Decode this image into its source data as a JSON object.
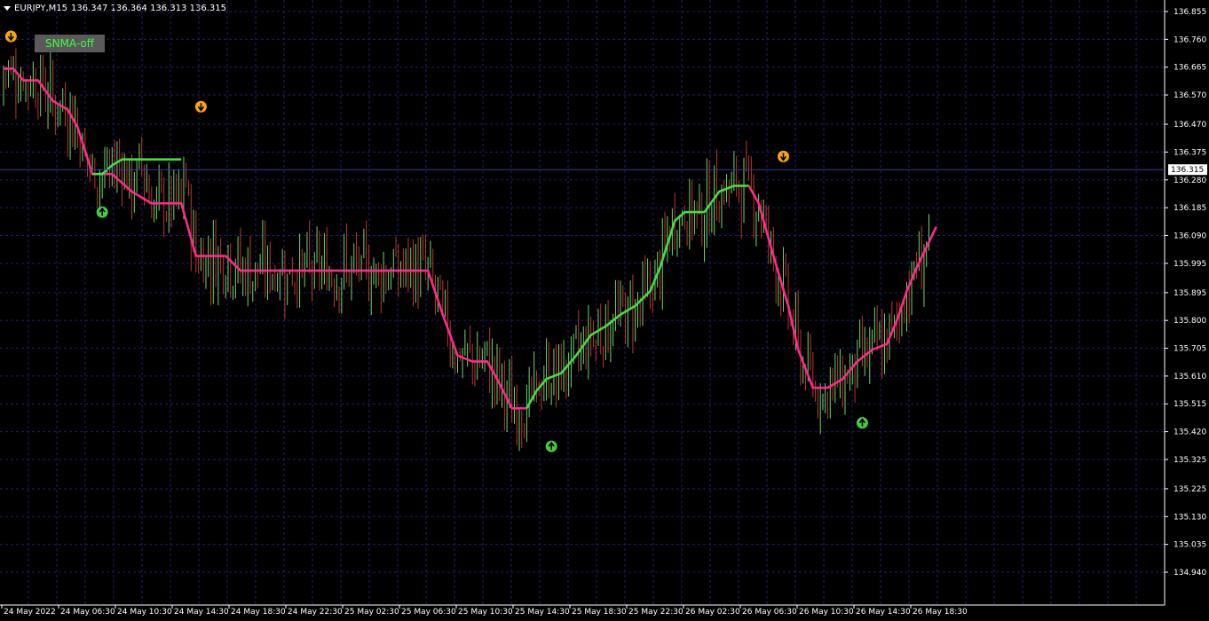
{
  "header": {
    "symbol": "EURJPY,M15",
    "ohlc": "136.347 136.364 136.313 136.315"
  },
  "button": {
    "label": "SNMA-off"
  },
  "colors": {
    "background": "#000000",
    "grid": "#1e1e6e",
    "up_bar": "#6bd66b",
    "down_bar": "#b83a2a",
    "sma_up": "#44dd44",
    "sma_down": "#ff2a8a",
    "arrow_down": "#ffa500",
    "arrow_up": "#44cc44"
  },
  "chart_data": {
    "type": "bar",
    "price_axis": {
      "labels": [
        "136.855",
        "136.760",
        "136.665",
        "136.570",
        "136.470",
        "136.375",
        "136.280",
        "136.185",
        "136.090",
        "135.995",
        "135.895",
        "135.800",
        "135.705",
        "135.610",
        "135.515",
        "135.420",
        "135.325",
        "135.225",
        "135.130",
        "135.035",
        "134.940"
      ],
      "current_price": "136.315",
      "range": [
        134.94,
        136.855
      ]
    },
    "time_axis": {
      "labels": [
        "24 May 2022",
        "24 May 06:30",
        "24 May 10:30",
        "24 May 14:30",
        "24 May 18:30",
        "24 May 22:30",
        "25 May 02:30",
        "25 May 06:30",
        "25 May 10:30",
        "25 May 14:30",
        "25 May 18:30",
        "25 May 22:30",
        "26 May 02:30",
        "26 May 06:30",
        "26 May 10:30",
        "26 May 14:30",
        "26 May 18:30"
      ]
    },
    "series": [
      {
        "color": "#ff2a8a",
        "points": [
          [
            0,
            136.66
          ],
          [
            4,
            136.66
          ],
          [
            8,
            136.62
          ],
          [
            14,
            136.62
          ],
          [
            20,
            136.55
          ],
          [
            26,
            136.52
          ],
          [
            30,
            136.46
          ],
          [
            36,
            136.3
          ],
          [
            44,
            136.3
          ],
          [
            52,
            136.24
          ],
          [
            60,
            136.2
          ],
          [
            72,
            136.2
          ],
          [
            78,
            136.02
          ],
          [
            90,
            136.02
          ],
          [
            96,
            135.97
          ],
          [
            130,
            135.97
          ],
          [
            172,
            135.97
          ],
          [
            174,
            135.92
          ],
          [
            178,
            135.82
          ],
          [
            184,
            135.68
          ],
          [
            190,
            135.66
          ],
          [
            196,
            135.66
          ],
          [
            200,
            135.6
          ],
          [
            206,
            135.5
          ],
          [
            212,
            135.5
          ]
        ]
      },
      {
        "color": "#44dd44",
        "points": [
          [
            36,
            136.3
          ],
          [
            40,
            136.3
          ],
          [
            44,
            136.33
          ],
          [
            48,
            136.35
          ],
          [
            56,
            136.35
          ],
          [
            72,
            136.35
          ]
        ]
      },
      {
        "color": "#44dd44",
        "points": [
          [
            212,
            135.5
          ],
          [
            216,
            135.56
          ],
          [
            220,
            135.6
          ],
          [
            226,
            135.62
          ],
          [
            232,
            135.68
          ],
          [
            238,
            135.75
          ],
          [
            244,
            135.78
          ],
          [
            250,
            135.82
          ],
          [
            256,
            135.85
          ],
          [
            262,
            135.9
          ],
          [
            266,
            135.98
          ],
          [
            272,
            136.14
          ],
          [
            276,
            136.17
          ],
          [
            284,
            136.17
          ],
          [
            290,
            136.24
          ],
          [
            296,
            136.26
          ],
          [
            302,
            136.26
          ]
        ]
      },
      {
        "color": "#ff2a8a",
        "points": [
          [
            302,
            136.26
          ],
          [
            306,
            136.2
          ],
          [
            312,
            136.02
          ],
          [
            318,
            135.85
          ],
          [
            322,
            135.7
          ],
          [
            328,
            135.57
          ],
          [
            334,
            135.57
          ],
          [
            340,
            135.6
          ],
          [
            346,
            135.66
          ],
          [
            352,
            135.7
          ],
          [
            358,
            135.72
          ],
          [
            362,
            135.8
          ],
          [
            366,
            135.9
          ],
          [
            370,
            135.98
          ],
          [
            374,
            136.05
          ],
          [
            378,
            136.12
          ]
        ]
      }
    ],
    "signals": [
      {
        "type": "down",
        "bar": 3,
        "price": 136.77
      },
      {
        "type": "up",
        "bar": 40,
        "price": 136.17
      },
      {
        "type": "down",
        "bar": 80,
        "price": 136.53
      },
      {
        "type": "up",
        "bar": 222,
        "price": 135.37
      },
      {
        "type": "down",
        "bar": 316,
        "price": 136.36
      },
      {
        "type": "up",
        "bar": 348,
        "price": 135.45
      }
    ]
  }
}
